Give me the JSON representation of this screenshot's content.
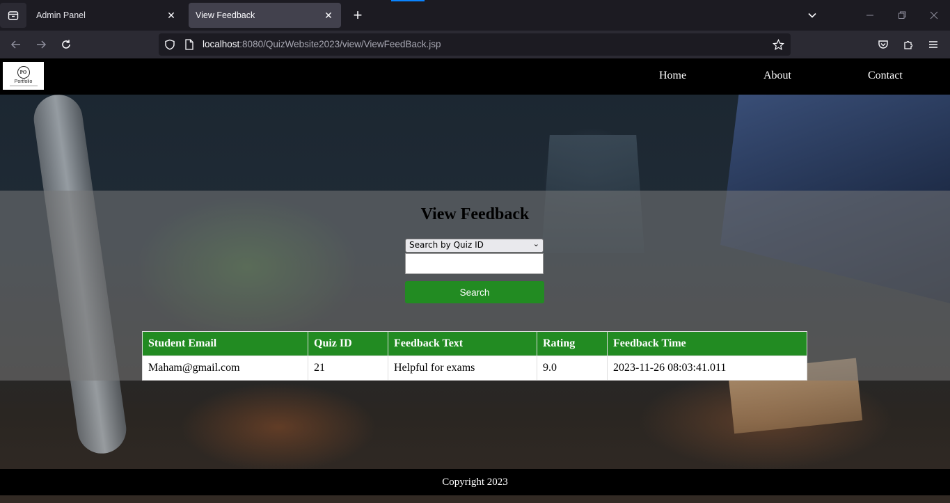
{
  "browser": {
    "tabs": [
      {
        "title": "Admin Panel",
        "active": false
      },
      {
        "title": "View Feedback",
        "active": true
      }
    ],
    "url": {
      "host": "localhost",
      "rest": ":8080/QuizWebsite2023/view/ViewFeedBack.jsp"
    }
  },
  "site": {
    "logo_text": "Portfolio",
    "logo_mark": "PO",
    "nav": [
      "Home",
      "About",
      "Contact"
    ],
    "footer": "Copyright 2023"
  },
  "main": {
    "title": "View Feedback",
    "search": {
      "select_value": "Search by Quiz ID",
      "input_value": "",
      "button_label": "Search"
    },
    "table": {
      "headers": [
        "Student Email",
        "Quiz ID",
        "Feedback Text",
        "Rating",
        "Feedback Time"
      ],
      "rows": [
        [
          "Maham@gmail.com",
          "21",
          "Helpful for exams",
          "9.0",
          "2023-11-26 08:03:41.011"
        ]
      ]
    }
  },
  "colors": {
    "accent": "#228b22",
    "header_bg": "#000000"
  }
}
